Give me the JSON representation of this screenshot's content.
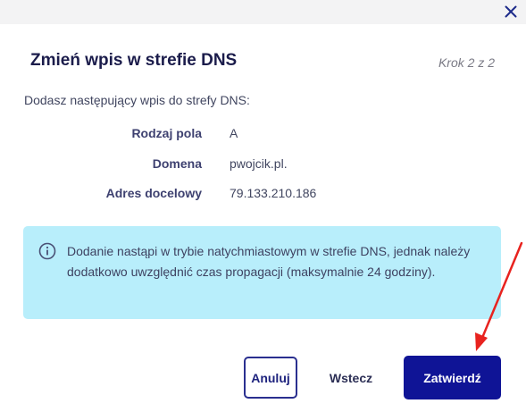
{
  "dialog": {
    "title": "Zmień wpis w strefie DNS",
    "step": "Krok 2 z 2",
    "intro": "Dodasz następujący wpis do strefy DNS:"
  },
  "record": {
    "fields": [
      {
        "label": "Rodzaj pola",
        "value": "A"
      },
      {
        "label": "Domena",
        "value": "pwojcik.pl."
      },
      {
        "label": "Adres docelowy",
        "value": "79.133.210.186"
      }
    ]
  },
  "info": {
    "icon": "info-icon",
    "text": "Dodanie nastąpi w trybie natychmiastowym w strefie DNS, jednak należy dodatkowo uwzględnić czas propagacji (maksymalnie 24 godziny)."
  },
  "buttons": {
    "cancel": "Anuluj",
    "back": "Wstecz",
    "confirm": "Zatwierdź"
  },
  "icons": {
    "close": "close-icon",
    "annotation": "red-arrow-annotation"
  },
  "colors": {
    "primary": "#0f1496",
    "info_bg": "#b8eefb",
    "annotation": "#e8231f"
  }
}
